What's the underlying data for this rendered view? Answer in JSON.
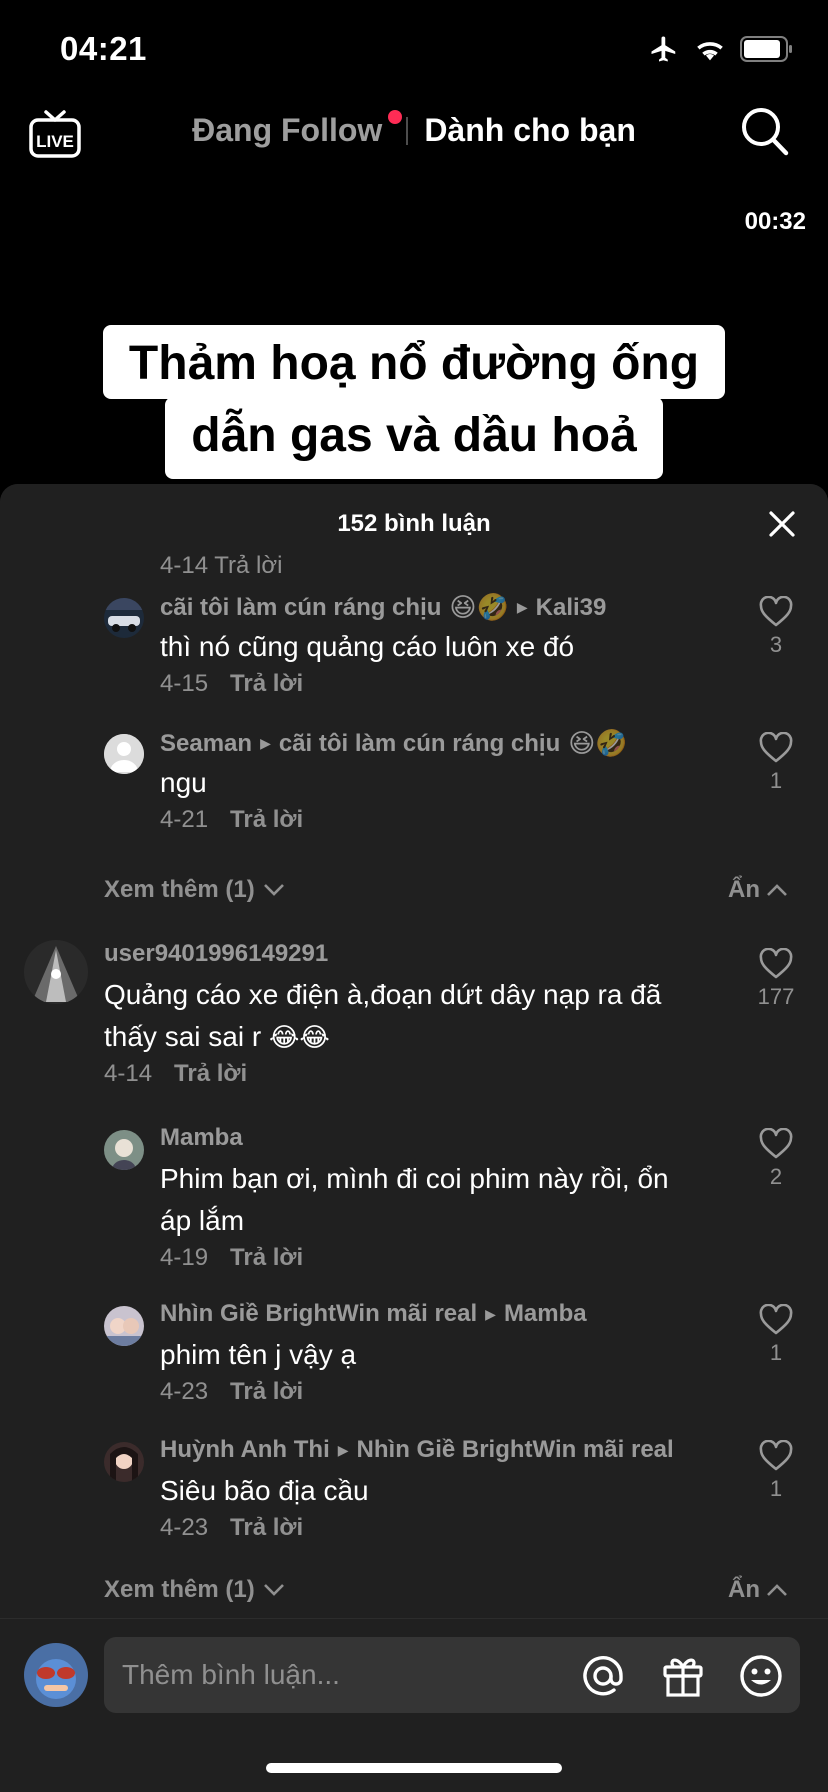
{
  "status_bar": {
    "time": "04:21"
  },
  "nav": {
    "following_label": "Đang Follow",
    "for_you_label": "Dành cho bạn",
    "live_label": "LIVE"
  },
  "video": {
    "timestamp": "00:32",
    "caption_line1": "Thảm hoạ nổ đường ống",
    "caption_line2": "dẫn gas và dầu hoả"
  },
  "sheet": {
    "title": "152 bình luận",
    "partial_meta": "4-14  Trả lời",
    "comments": [
      {
        "user": "cãi tôi làm cún ráng chịu",
        "user_emoji": "😆🤣",
        "reply_to": "Kali39",
        "reply_to_emoji": "",
        "text": "thì nó cũng quảng cáo luôn xe đó",
        "date": "4-15",
        "reply": "Trả lời",
        "likes": "3"
      },
      {
        "user": "Seaman",
        "user_emoji": "",
        "reply_to": "cãi tôi làm cún ráng chịu",
        "reply_to_emoji": "😆🤣",
        "text": "ngu",
        "date": "4-21",
        "reply": "Trả lời",
        "likes": "1"
      },
      {
        "user": "user9401996149291",
        "text": "Quảng cáo xe điện à,đoạn dứt dây nạp ra đã thấy sai sai r",
        "text_emoji": "😂😂",
        "date": "4-14",
        "reply": "Trả lời",
        "likes": "177"
      },
      {
        "user": "Mamba",
        "text": "Phim bạn ơi, mình đi coi phim này rồi, ổn áp lắm",
        "date": "4-19",
        "reply": "Trả lời",
        "likes": "2"
      },
      {
        "user": "Nhìn Giề BrightWin mãi real",
        "reply_to": "Mamba",
        "text": "phim tên j vậy ạ",
        "date": "4-23",
        "reply": "Trả lời",
        "likes": "1"
      },
      {
        "user": "Huỳnh Anh Thi",
        "reply_to": "Nhìn Giề BrightWin mãi real",
        "text": "Siêu bão địa cầu",
        "date": "4-23",
        "reply": "Trả lời",
        "likes": "1"
      }
    ],
    "view_more_1": "Xem thêm (1)",
    "hide_1": "Ẩn",
    "view_more_2": "Xem thêm (1)",
    "hide_2": "Ẩn"
  },
  "input": {
    "placeholder": "Thêm bình luận..."
  }
}
